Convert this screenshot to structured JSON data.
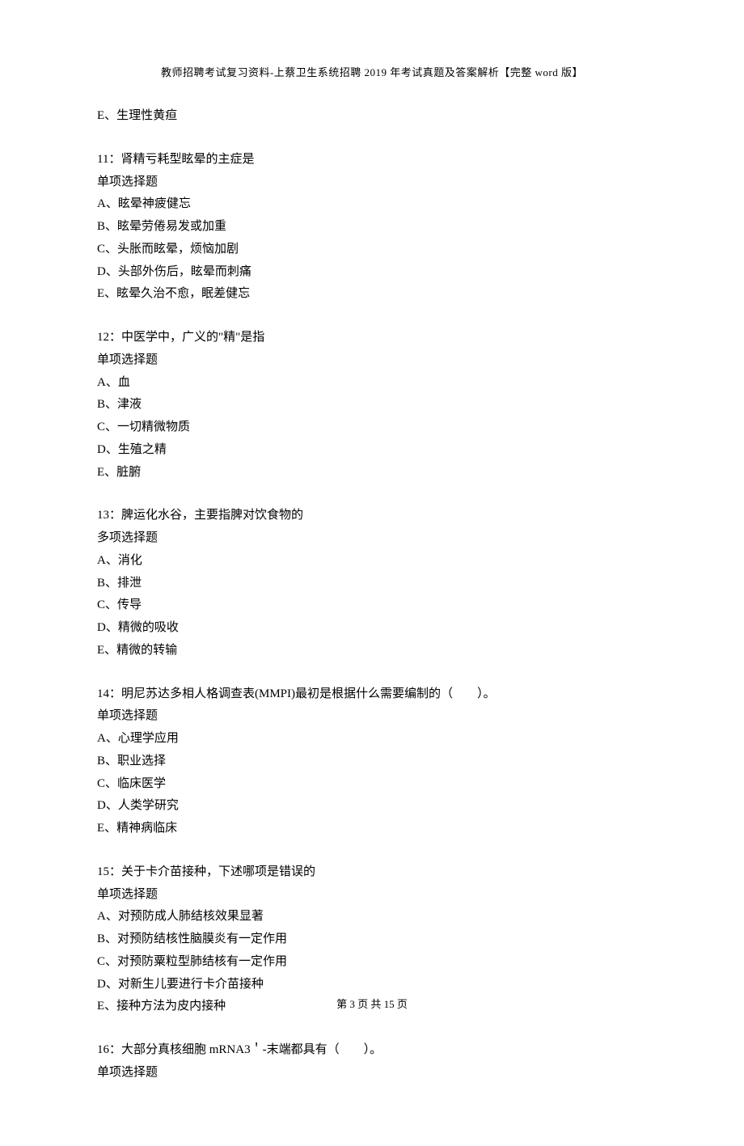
{
  "header": "教师招聘考试复习资料-上蔡卫生系统招聘 2019 年考试真题及答案解析【完整 word 版】",
  "leading_option": "E、生理性黄疸",
  "questions": [
    {
      "title": "11：肾精亏耗型眩晕的主症是",
      "type": "单项选择题",
      "options": [
        "A、眩晕神疲健忘",
        "B、眩晕劳倦易发或加重",
        "C、头胀而眩晕，烦恼加剧",
        "D、头部外伤后，眩晕而刺痛",
        "E、眩晕久治不愈，眠差健忘"
      ]
    },
    {
      "title": "12：中医学中，广义的\"精\"是指",
      "type": "单项选择题",
      "options": [
        "A、血",
        "B、津液",
        "C、一切精微物质",
        "D、生殖之精",
        "E、脏腑"
      ]
    },
    {
      "title": "13：脾运化水谷，主要指脾对饮食物的",
      "type": "多项选择题",
      "options": [
        "A、消化",
        "B、排泄",
        "C、传导",
        "D、精微的吸收",
        "E、精微的转输"
      ]
    },
    {
      "title": "14：明尼苏达多相人格调查表(MMPI)最初是根据什么需要编制的（　　）。",
      "type": "单项选择题",
      "options": [
        "A、心理学应用",
        "B、职业选择",
        "C、临床医学",
        "D、人类学研究",
        "E、精神病临床"
      ]
    },
    {
      "title": "15：关于卡介苗接种，下述哪项是错误的",
      "type": "单项选择题",
      "options": [
        "A、对预防成人肺结核效果显著",
        "B、对预防结核性脑膜炎有一定作用",
        "C、对预防粟粒型肺结核有一定作用",
        "D、对新生儿要进行卡介苗接种",
        "E、接种方法为皮内接种"
      ]
    },
    {
      "title": "16：大部分真核细胞 mRNA3＇-末端都具有（　　）。",
      "type": "单项选择题",
      "options": []
    }
  ],
  "footer": "第 3 页 共 15 页"
}
